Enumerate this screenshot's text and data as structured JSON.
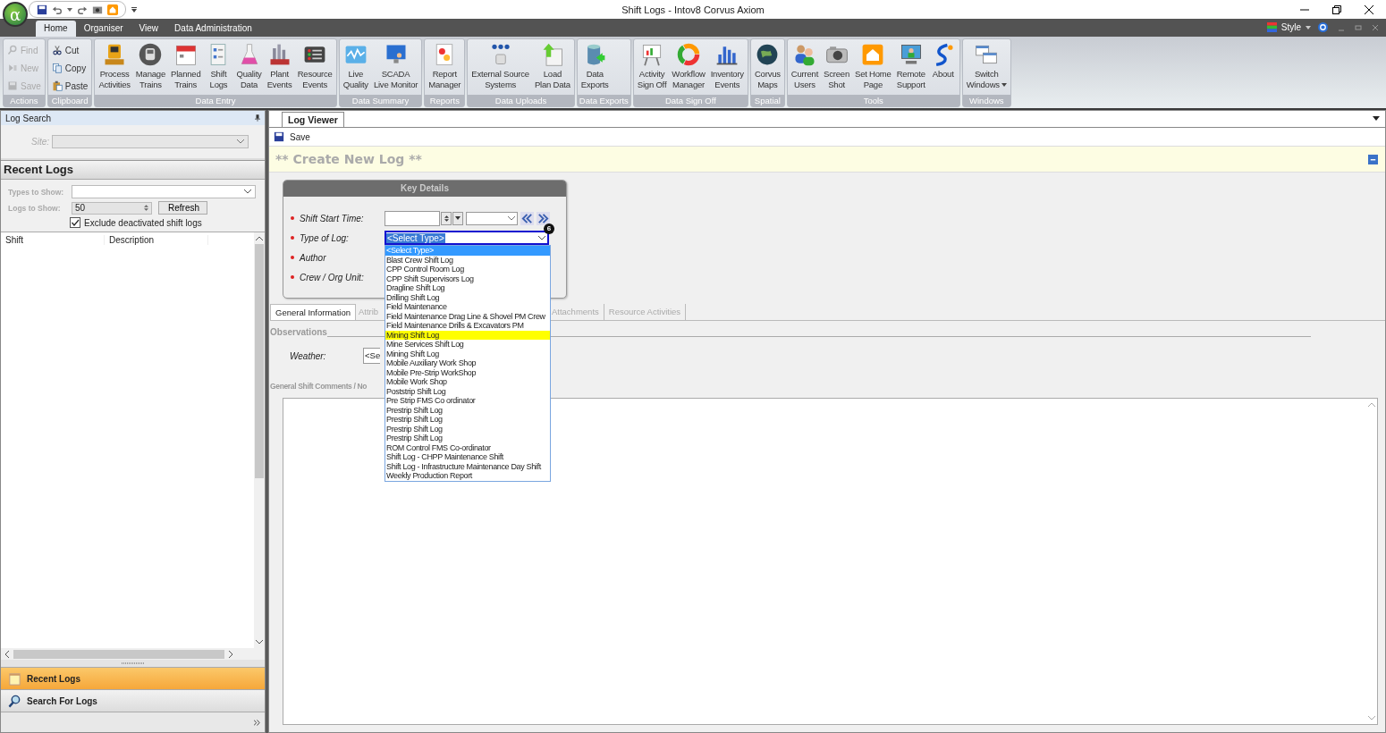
{
  "window": {
    "title": "Shift Logs - Intov8 Corvus Axiom",
    "logo": "α"
  },
  "menu_tabs": [
    {
      "label": "Home",
      "selected": true
    },
    {
      "label": "Organiser",
      "selected": false
    },
    {
      "label": "View",
      "selected": false
    },
    {
      "label": "Data Administration",
      "selected": false
    }
  ],
  "style_menu": {
    "label": "Style"
  },
  "ribbon": {
    "groups": [
      {
        "label": "Actions",
        "kind": "small",
        "buttons": [
          {
            "label": "Find",
            "disabled": true
          },
          {
            "label": "New",
            "disabled": true
          },
          {
            "label": "Save",
            "disabled": true
          }
        ]
      },
      {
        "label": "Clipboard",
        "kind": "small",
        "buttons": [
          {
            "label": "Cut",
            "disabled": false
          },
          {
            "label": "Copy",
            "disabled": false
          },
          {
            "label": "Paste",
            "disabled": false
          }
        ]
      },
      {
        "label": "Data Entry",
        "kind": "large",
        "buttons": [
          {
            "label": "Process\nActivities"
          },
          {
            "label": "Manage\nTrains"
          },
          {
            "label": "Planned\nTrains"
          },
          {
            "label": "Shift\nLogs"
          },
          {
            "label": "Quality\nData"
          },
          {
            "label": "Plant\nEvents"
          },
          {
            "label": "Resource\nEvents"
          }
        ]
      },
      {
        "label": "Data Summary",
        "kind": "large",
        "buttons": [
          {
            "label": "Live\nQuality"
          },
          {
            "label": "SCADA\nLive Monitor"
          }
        ]
      },
      {
        "label": "Reports",
        "kind": "large",
        "buttons": [
          {
            "label": "Report\nManager"
          }
        ]
      },
      {
        "label": "Data Uploads",
        "kind": "large",
        "buttons": [
          {
            "label": "External Source\nSystems"
          },
          {
            "label": "Load\nPlan Data"
          }
        ]
      },
      {
        "label": "Data Exports",
        "kind": "large",
        "buttons": [
          {
            "label": "Data\nExports"
          }
        ]
      },
      {
        "label": "Data Sign Off",
        "kind": "large",
        "buttons": [
          {
            "label": "Activity\nSign Off"
          },
          {
            "label": "Workflow\nManager"
          },
          {
            "label": "Inventory\nEvents"
          }
        ]
      },
      {
        "label": "Spatial",
        "kind": "large",
        "buttons": [
          {
            "label": "Corvus\nMaps"
          }
        ]
      },
      {
        "label": "Tools",
        "kind": "large",
        "buttons": [
          {
            "label": "Current\nUsers"
          },
          {
            "label": "Screen\nShot"
          },
          {
            "label": "Set Home\nPage"
          },
          {
            "label": "Remote\nSupport"
          },
          {
            "label": "About"
          }
        ]
      },
      {
        "label": "Windows",
        "kind": "large",
        "buttons": [
          {
            "label": "Switch\nWindows",
            "has_menu": true
          }
        ]
      }
    ]
  },
  "log_search": {
    "title": "Log Search",
    "site": {
      "label": "Site:",
      "disabled": true
    }
  },
  "recent_logs": {
    "title": "Recent Logs",
    "types_label": "Types to Show:",
    "logs_label": "Logs to Show:",
    "logs_value": "50",
    "refresh": "Refresh",
    "exclude": {
      "label": "Exclude deactivated shift logs",
      "checked": true
    },
    "columns": [
      "Shift",
      "Description"
    ]
  },
  "nav": [
    {
      "label": "Recent Logs",
      "selected": true
    },
    {
      "label": "Search For Logs",
      "selected": false
    }
  ],
  "viewer": {
    "tab": "Log Viewer",
    "save": "Save",
    "banner": "** Create New Log **",
    "card_title": "Key Details",
    "fields": [
      {
        "label": "Shift Start Time:",
        "kind": "datetime",
        "required": true
      },
      {
        "label": "Type of Log:",
        "kind": "select",
        "required": true,
        "value": "<Select Type>",
        "badge": "6",
        "options": [
          {
            "label": "<Select Type>",
            "selected": true,
            "hovered": false
          },
          {
            "label": "Blast Crew Shift Log",
            "selected": false,
            "hovered": false
          },
          {
            "label": "CPP Control Room Log",
            "selected": false,
            "hovered": false
          },
          {
            "label": "CPP Shift Supervisors Log",
            "selected": false,
            "hovered": false
          },
          {
            "label": "Dragline Shift Log",
            "selected": false,
            "hovered": false
          },
          {
            "label": "Drilling Shift Log",
            "selected": false,
            "hovered": false
          },
          {
            "label": "Field Maintenance",
            "selected": false,
            "hovered": false
          },
          {
            "label": "Field Maintenance Drag Line & Shovel PM Crew",
            "selected": false,
            "hovered": false
          },
          {
            "label": "Field Maintenance Drills & Excavators PM",
            "selected": false,
            "hovered": false
          },
          {
            "label": "Mining Shift Log",
            "selected": false,
            "hovered": true
          },
          {
            "label": "Mine Services Shift Log",
            "selected": false,
            "hovered": false
          },
          {
            "label": "Mining Shift Log",
            "selected": false,
            "hovered": false
          },
          {
            "label": "Mobile Auxiliary Work Shop",
            "selected": false,
            "hovered": false
          },
          {
            "label": "Mobile Pre-Strip WorkShop",
            "selected": false,
            "hovered": false
          },
          {
            "label": "Mobile Work Shop",
            "selected": false,
            "hovered": false
          },
          {
            "label": "Poststrip Shift Log",
            "selected": false,
            "hovered": false
          },
          {
            "label": "Pre Strip FMS Co ordinator",
            "selected": false,
            "hovered": false
          },
          {
            "label": "Prestrip Shift Log",
            "selected": false,
            "hovered": false
          },
          {
            "label": "Prestrip Shift Log",
            "selected": false,
            "hovered": false
          },
          {
            "label": "Prestrip Shift Log",
            "selected": false,
            "hovered": false
          },
          {
            "label": "Prestrip Shift Log",
            "selected": false,
            "hovered": false
          },
          {
            "label": "ROM Control FMS Co-ordinator",
            "selected": false,
            "hovered": false
          },
          {
            "label": "Shift Log - CHPP Maintenance  Shift",
            "selected": false,
            "hovered": false
          },
          {
            "label": "Shift Log - Infrastructure Maintenance Day Shift",
            "selected": false,
            "hovered": false
          },
          {
            "label": "Weekly Production Report",
            "selected": false,
            "hovered": false
          }
        ]
      },
      {
        "label": "Author",
        "kind": "plain",
        "required": true
      },
      {
        "label": "Crew / Org Unit:",
        "kind": "plain",
        "required": true
      }
    ],
    "tabs": [
      {
        "label": "General Information",
        "selected": true
      },
      {
        "label": "Attrib",
        "selected": false
      },
      {
        "label": "Attachments",
        "selected": false
      },
      {
        "label": "Resource Activities",
        "selected": false
      }
    ],
    "section": "Observations",
    "weather": {
      "label": "Weather:",
      "value": "<Se"
    },
    "comments_label": "General Shift Comments / No"
  }
}
